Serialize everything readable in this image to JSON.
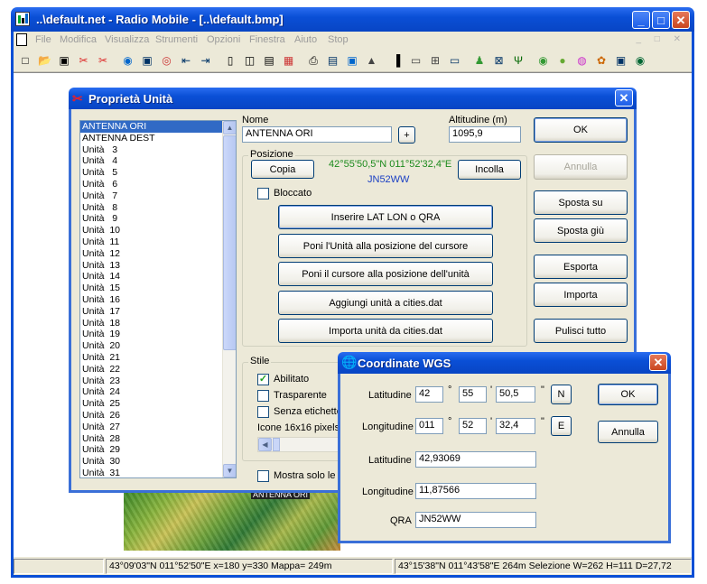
{
  "app": {
    "title": "..\\default.net - Radio Mobile - [..\\default.bmp]",
    "menu": [
      "File",
      "Modifica",
      "Visualizza",
      "Strumenti",
      "Opzioni",
      "Finestra",
      "Aiuto",
      "Stop"
    ]
  },
  "toolbar_icons": [
    "new-icon",
    "open-icon",
    "copy-icon",
    "units-icon",
    "network-icon",
    "globe-icon",
    "radio-icon",
    "search-icon",
    "first-icon",
    "last-icon",
    "panel-icon",
    "resize-icon",
    "save-icon",
    "chart-icon",
    "print-icon",
    "paste-icon",
    "page-icon",
    "mountain-icon",
    "gradient-icon",
    "ruler-icon",
    "grid-icon",
    "box-icon",
    "people-icon",
    "zoom-icon",
    "antenna-icon",
    "target-icon",
    "earth-icon",
    "colorwheel-icon",
    "plugin-icon",
    "book-icon",
    "help-icon"
  ],
  "status": {
    "left": "43°09'03\"N  011°52'50\"E  x=180 y=330 Mappa= 249m",
    "right": "43°15'38\"N 011°43'58\"E 264m Selezione W=262 H=111 D=27,72"
  },
  "map_label": "ANTENNA ORI",
  "units_dialog": {
    "title": "Proprietà Unità",
    "units": [
      "ANTENNA ORI",
      "ANTENNA DEST",
      "Unità   3",
      "Unità   4",
      "Unità   5",
      "Unità   6",
      "Unità   7",
      "Unità   8",
      "Unità   9",
      "Unità  10",
      "Unità  11",
      "Unità  12",
      "Unità  13",
      "Unità  14",
      "Unità  15",
      "Unità  16",
      "Unità  17",
      "Unità  18",
      "Unità  19",
      "Unità  20",
      "Unità  21",
      "Unità  22",
      "Unità  23",
      "Unità  24",
      "Unità  25",
      "Unità  26",
      "Unità  27",
      "Unità  28",
      "Unità  29",
      "Unità  30",
      "Unità  31"
    ],
    "name_label": "Nome",
    "name_value": "ANTENNA ORI",
    "plus": "+",
    "altitude_label": "Altitudine (m)",
    "altitude_value": "1095,9",
    "position_label": "Posizione",
    "copy": "Copia",
    "coords": "42°55'50,5\"N 011°52'32,4\"E",
    "qra": "JN52WW",
    "paste": "Incolla",
    "locked": "Bloccato",
    "actions": [
      "Inserire LAT LON o QRA",
      "Poni l'Unità alla posizione del cursore",
      "Poni il cursore alla posizione dell'unità",
      "Aggiungi unità a cities.dat",
      "Importa unità da cities.dat"
    ],
    "ok": "OK",
    "cancel": "Annulla",
    "move_up": "Sposta su",
    "move_down": "Sposta giù",
    "export": "Esporta",
    "import": "Importa",
    "clear_all": "Pulisci tutto",
    "style_label": "Stile",
    "enabled": "Abilitato",
    "transparent": "Trasparente",
    "no_labels": "Senza etichette",
    "icons_label": "Icone 16x16 pixels",
    "show_only": "Mostra solo le u"
  },
  "wgs_dialog": {
    "title": "Coordinate WGS",
    "lat_label": "Latitudine",
    "lat_deg": "42",
    "lat_min": "55",
    "lat_sec": "50,5",
    "lat_hemi": "N",
    "lon_label": "Longitudine",
    "lon_deg": "011",
    "lon_min": "52",
    "lon_sec": "32,4",
    "lon_hemi": "E",
    "deg_sym": "°",
    "min_sym": "'",
    "sec_sym": "\"",
    "lat_dec": "42,93069",
    "lon_dec": "11,87566",
    "qra_label": "QRA",
    "qra_value": "JN52WW",
    "ok": "OK",
    "cancel": "Annulla"
  }
}
